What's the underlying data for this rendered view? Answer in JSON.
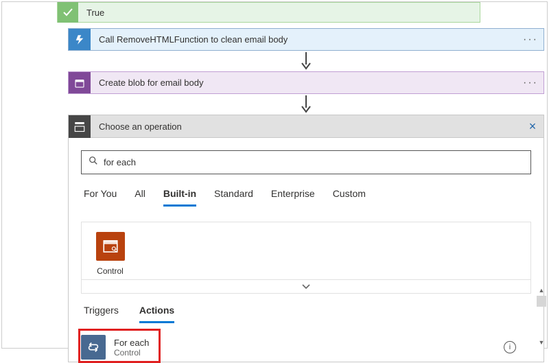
{
  "true_branch": {
    "label": "True"
  },
  "actions": {
    "func_title": "Call RemoveHTMLFunction to clean email body",
    "blob_title": "Create blob for email body"
  },
  "op_picker": {
    "header": "Choose an operation",
    "search_value": "for each",
    "categories": [
      "For You",
      "All",
      "Built-in",
      "Standard",
      "Enterprise",
      "Custom"
    ],
    "active_category": "Built-in",
    "connector": {
      "label": "Control"
    },
    "result_tabs": [
      "Triggers",
      "Actions"
    ],
    "active_result_tab": "Actions",
    "result": {
      "title": "For each",
      "subtitle": "Control"
    }
  }
}
